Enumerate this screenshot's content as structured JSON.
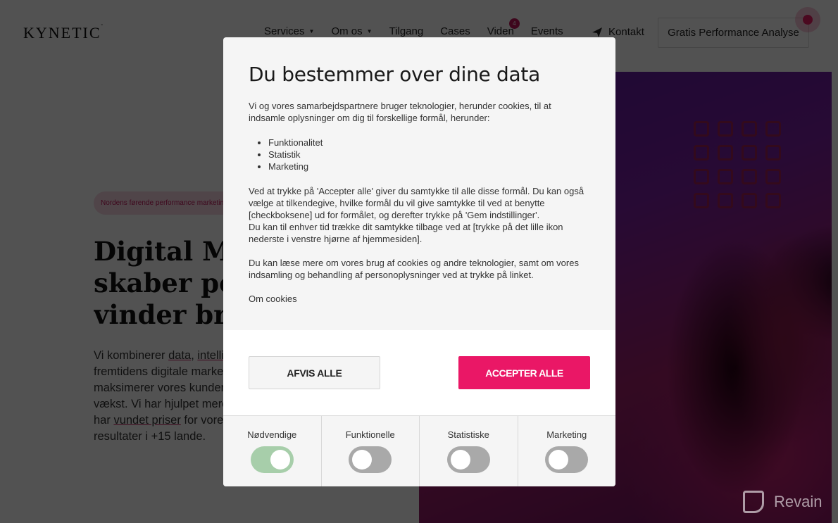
{
  "header": {
    "logo": "KYNETIC",
    "nav": [
      {
        "label": "Services",
        "has_dropdown": true
      },
      {
        "label": "Om os",
        "has_dropdown": true
      },
      {
        "label": "Tilgang",
        "has_dropdown": false
      },
      {
        "label": "Cases",
        "has_dropdown": false
      },
      {
        "label": "Viden",
        "has_dropdown": false,
        "badge": "4"
      },
      {
        "label": "Events",
        "has_dropdown": false
      }
    ],
    "contact_label": "Kontakt",
    "contact_icon": "paper-plane-icon",
    "cta_label": "Gratis Performance Analyse"
  },
  "hero": {
    "pill": "Nordens førende performance marketing bureau",
    "title_lines": [
      "Digital Marketing der",
      "skaber performance og",
      "vinder brands"
    ],
    "text_lines": [
      {
        "parts": [
          {
            "t": "Vi kombinerer "
          },
          {
            "t": "data",
            "link": true
          },
          {
            "t": ", "
          },
          {
            "t": "intelligens",
            "link": true
          }
        ]
      },
      {
        "parts": [
          {
            "t": "fremtidens digitale marketing og"
          }
        ]
      },
      {
        "parts": [
          {
            "t": "maksimerer vores kunders"
          }
        ]
      },
      {
        "parts": [
          {
            "t": "vækst. Vi har hjulpet mere end"
          }
        ]
      },
      {
        "parts": [
          {
            "t": "har "
          },
          {
            "t": "vundet priser",
            "link": true
          },
          {
            "t": " for vores"
          }
        ]
      },
      {
        "parts": [
          {
            "t": "resultater i +15 lande."
          }
        ]
      }
    ]
  },
  "cookie_modal": {
    "title": "Du bestemmer over dine data",
    "intro": "Vi og vores samarbejdspartnere bruger teknologier, herunder cookies, til at indsamle oplysninger om dig til forskellige formål, herunder:",
    "purposes": [
      "Funktionalitet",
      "Statistik",
      "Marketing"
    ],
    "consent_text_1": "Ved at trykke på 'Accepter alle' giver du samtykke til alle disse formål. Du kan også vælge at tilkendegive, hvilke formål du vil give samtykke til ved at benytte [checkboksene] ud for formålet, og derefter trykke på 'Gem indstillinger'.",
    "consent_text_2": "Du kan til enhver tid trække dit samtykke tilbage ved at [trykke på det lille ikon nederste i venstre hjørne af hjemmesiden].",
    "more_info": "Du kan læse mere om vores brug af cookies og andre teknologier, samt om vores indsamling og behandling af personoplysninger ved at trykke på linket.",
    "cookie_link": "Om cookies",
    "reject_label": "AFVIS ALLE",
    "accept_label": "ACCEPTER ALLE",
    "toggles": [
      {
        "label": "Nødvendige",
        "on": true
      },
      {
        "label": "Funktionelle",
        "on": false
      },
      {
        "label": "Statistiske",
        "on": false
      },
      {
        "label": "Marketing",
        "on": false
      }
    ]
  },
  "colors": {
    "accent": "#ea1766",
    "toggle_on": "#a7ceaa",
    "toggle_off": "#a9a9a9"
  },
  "watermark": "Revain"
}
